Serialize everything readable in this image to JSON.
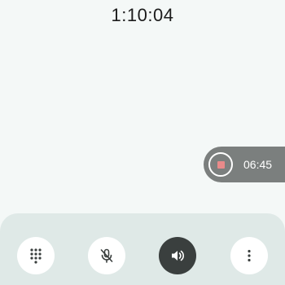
{
  "call": {
    "duration": "1:10:04"
  },
  "recording": {
    "elapsed": "06:45",
    "stop_icon": "record-stop-icon",
    "colors": {
      "pill": "#7b7f7e",
      "stop": "#e88a8a"
    }
  },
  "controls": {
    "items": [
      {
        "icon": "dialpad-icon",
        "active": false
      },
      {
        "icon": "mic-off-icon",
        "active": false
      },
      {
        "icon": "speaker-icon",
        "active": true
      },
      {
        "icon": "more-vertical-icon",
        "active": false
      }
    ],
    "colors": {
      "panel": "#dfe9e7",
      "button": "#ffffff",
      "active_button": "#3a3f3e"
    }
  }
}
